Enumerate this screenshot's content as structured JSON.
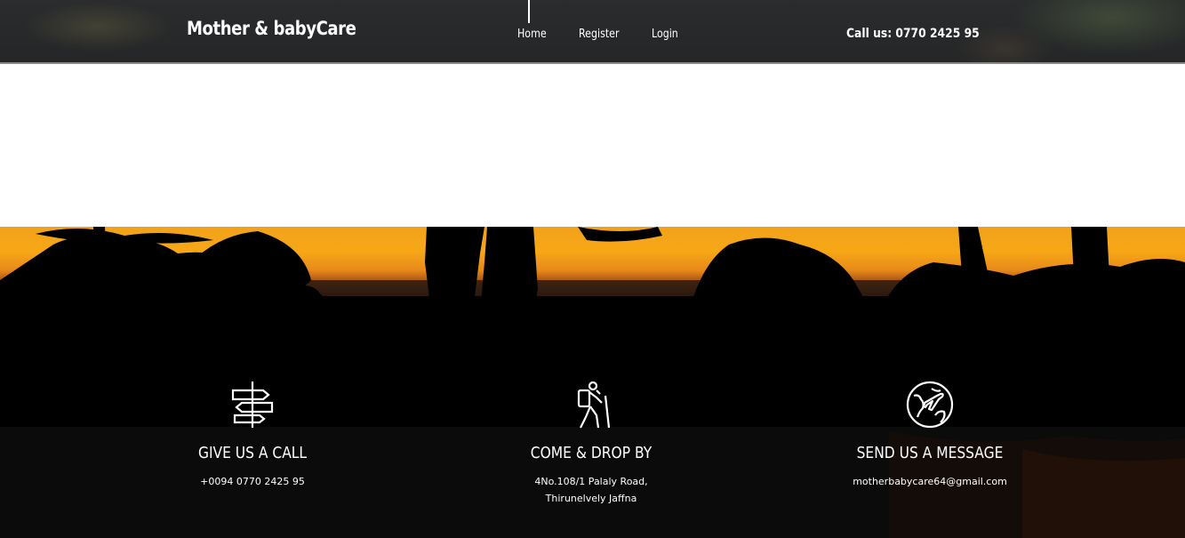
{
  "header": {
    "brand": "Mother & babyCare",
    "nav": [
      {
        "label": "Home"
      },
      {
        "label": "Register"
      },
      {
        "label": "Login"
      }
    ],
    "call": "Call us: 0770 2425 95"
  },
  "contact": [
    {
      "icon": "signpost-icon",
      "title": "GIVE US A CALL",
      "lines": [
        "+0094 0770 2425 95"
      ]
    },
    {
      "icon": "hiker-icon",
      "title": "COME & DROP BY",
      "lines": [
        "4No.108/1 Palaly Road,",
        "Thirunelvely Jaffna"
      ]
    },
    {
      "icon": "globe-plane-icon",
      "title": "SEND US A MESSAGE",
      "lines": [
        "motherbabycare64@gmail.com"
      ]
    }
  ]
}
